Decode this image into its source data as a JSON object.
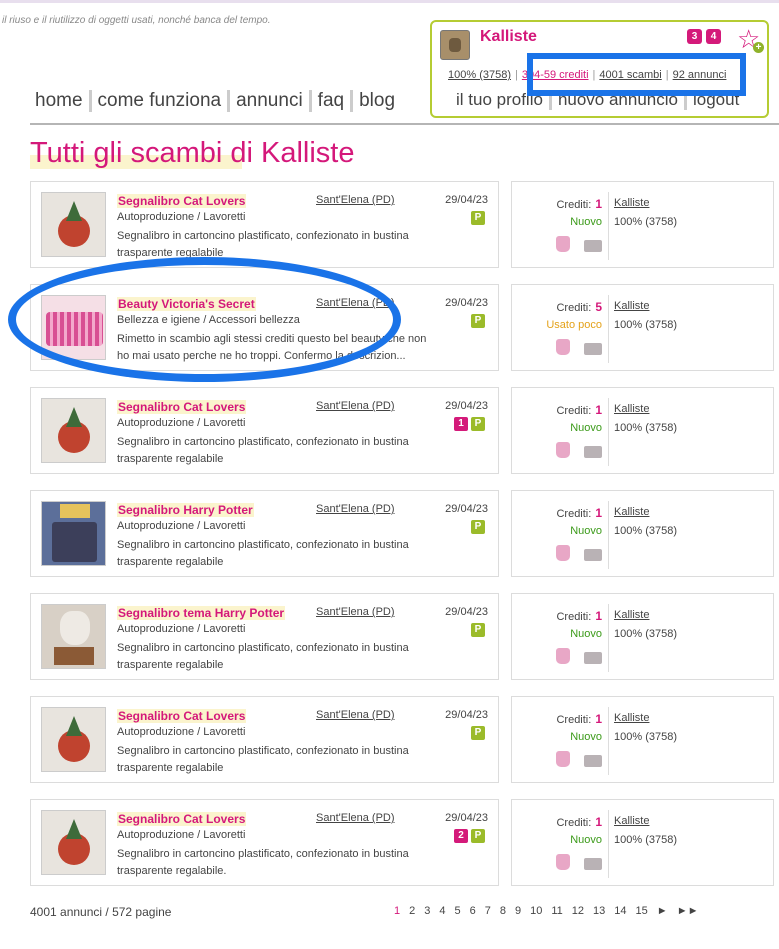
{
  "header": {
    "tagline": "il riuso e il riutilizzo di oggetti usati, nonché banca del tempo."
  },
  "nav": [
    "home",
    "come funziona",
    "annunci",
    "faq",
    "blog"
  ],
  "user": {
    "name": "Kalliste",
    "badges": [
      "3",
      "4"
    ],
    "rating": "100% (3758)",
    "credits": "304-59  crediti",
    "exchanges": "4001 scambi",
    "ads": "92 annunci",
    "links": [
      "il tuo profilo",
      "nuovo annuncio",
      "logout"
    ]
  },
  "page_title": "Tutti gli scambi di Kalliste",
  "listings": [
    {
      "title": "Segnalibro Cat Lovers",
      "location": "Sant'Elena (PD)",
      "date": "29/04/23",
      "category": "Autoproduzione / Lavoretti",
      "description": "Segnalibro in cartoncino plastificato, confezionato in bustina trasparente regalabile",
      "tags": [
        "P"
      ],
      "credits": "1",
      "condition": "Nuovo",
      "owner": "Kalliste",
      "owner_rating": "100% (3758)"
    },
    {
      "title": "Beauty Victoria's Secret",
      "location": "Sant'Elena (PD)",
      "date": "29/04/23",
      "category": "Bellezza e igiene / Accessori bellezza",
      "description": "Rimetto in scambio agli stessi crediti questo bel beauty che non ho mai usato perche ne ho troppi. Confermo la descrizion...",
      "tags": [
        "P"
      ],
      "credits": "5",
      "condition": "Usato poco",
      "owner": "Kalliste",
      "owner_rating": "100% (3758)"
    },
    {
      "title": "Segnalibro Cat Lovers",
      "location": "Sant'Elena (PD)",
      "date": "29/04/23",
      "category": "Autoproduzione / Lavoretti",
      "description": "Segnalibro in cartoncino plastificato, confezionato in bustina trasparente regalabile",
      "tags": [
        "1",
        "P"
      ],
      "credits": "1",
      "condition": "Nuovo",
      "owner": "Kalliste",
      "owner_rating": "100% (3758)"
    },
    {
      "title": "Segnalibro Harry Potter",
      "location": "Sant'Elena (PD)",
      "date": "29/04/23",
      "category": "Autoproduzione / Lavoretti",
      "description": "Segnalibro in cartoncino plastificato, confezionato in bustina trasparente regalabile",
      "tags": [
        "P"
      ],
      "credits": "1",
      "condition": "Nuovo",
      "owner": "Kalliste",
      "owner_rating": "100% (3758)"
    },
    {
      "title": "Segnalibro tema Harry Potter",
      "location": "Sant'Elena (PD)",
      "date": "29/04/23",
      "category": "Autoproduzione / Lavoretti",
      "description": "Segnalibro in cartoncino plastificato, confezionato in bustina trasparente regalabile",
      "tags": [
        "P"
      ],
      "credits": "1",
      "condition": "Nuovo",
      "owner": "Kalliste",
      "owner_rating": "100% (3758)"
    },
    {
      "title": "Segnalibro Cat Lovers",
      "location": "Sant'Elena (PD)",
      "date": "29/04/23",
      "category": "Autoproduzione / Lavoretti",
      "description": "Segnalibro in cartoncino plastificato, confezionato in bustina trasparente regalabile",
      "tags": [
        "P"
      ],
      "credits": "1",
      "condition": "Nuovo",
      "owner": "Kalliste",
      "owner_rating": "100% (3758)"
    },
    {
      "title": "Segnalibro Cat Lovers",
      "location": "Sant'Elena (PD)",
      "date": "29/04/23",
      "category": "Autoproduzione / Lavoretti",
      "description": "Segnalibro in cartoncino plastificato, confezionato in bustina trasparente regalabile.",
      "tags": [
        "2",
        "P"
      ],
      "credits": "1",
      "condition": "Nuovo",
      "owner": "Kalliste",
      "owner_rating": "100% (3758)"
    }
  ],
  "labels": {
    "credits": "Crediti:"
  },
  "footer": {
    "summary": "4001 annunci / 572 pagine",
    "pages": [
      "1",
      "2",
      "3",
      "4",
      "5",
      "6",
      "7",
      "8",
      "9",
      "10",
      "11",
      "12",
      "13",
      "14",
      "15"
    ],
    "next": "►",
    "last": "►►"
  },
  "icons": [
    "avatar-image",
    "star-add-icon",
    "hand-icon",
    "truck-icon"
  ],
  "colors": {
    "accent": "#d4187a",
    "highlight_bg": "#fbf4cd",
    "green": "#9bbb2a",
    "condition_new": "#3b9a19",
    "condition_used": "#e4a21a",
    "annotation_blue": "#1a73e8"
  }
}
